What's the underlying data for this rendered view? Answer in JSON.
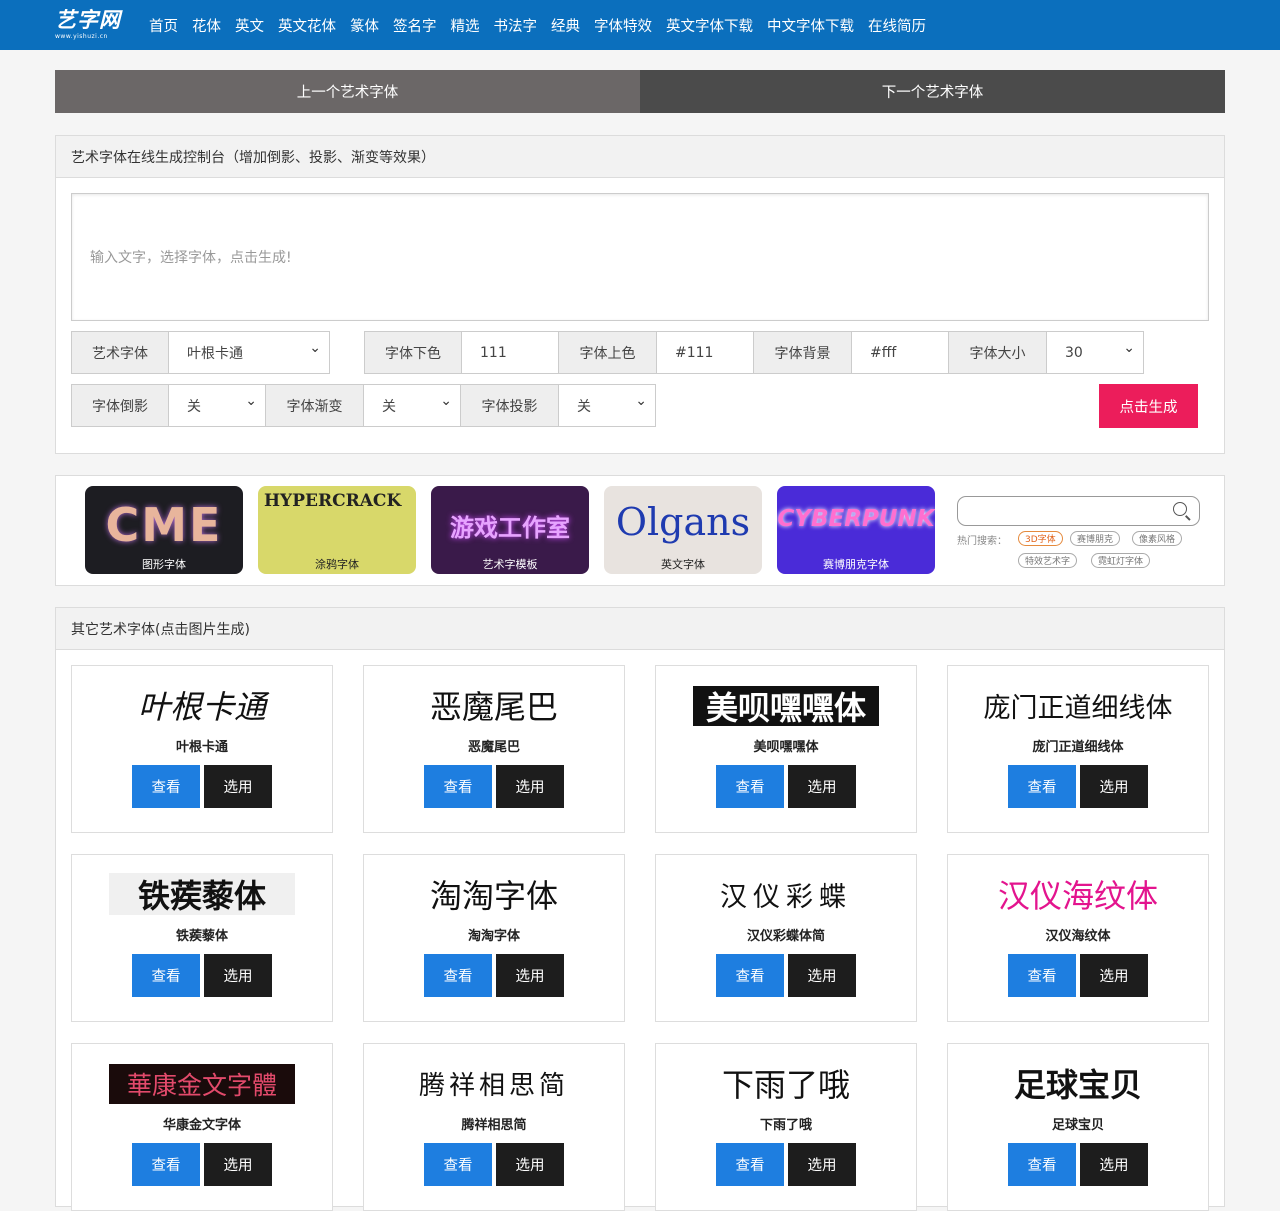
{
  "header": {
    "logo_text": "艺字网",
    "logo_sub": "www.yishuzi.cn",
    "nav": [
      "首页",
      "花体",
      "英文",
      "英文花体",
      "篆体",
      "签名字",
      "精选",
      "书法字",
      "经典",
      "字体特效",
      "英文字体下载",
      "中文字体下载",
      "在线简历"
    ]
  },
  "pager": {
    "prev": "上一个艺术字体",
    "next": "下一个艺术字体"
  },
  "control": {
    "title": "艺术字体在线生成控制台（增加倒影、投影、渐变等效果）",
    "textarea_placeholder": "输入文字，选择字体，点击生成!",
    "font_label": "艺术字体",
    "font_value": "叶根卡通",
    "bottom_color_label": "字体下色",
    "bottom_color_value": "111",
    "top_color_label": "字体上色",
    "top_color_value": "#111",
    "bg_label": "字体背景",
    "bg_value": "#fff",
    "size_label": "字体大小",
    "size_value": "30",
    "reflect_label": "字体倒影",
    "reflect_value": "关",
    "gradient_label": "字体渐变",
    "gradient_value": "关",
    "shadow_label": "字体投影",
    "shadow_value": "关",
    "generate_button": "点击生成"
  },
  "banner": {
    "tiles": [
      {
        "caption": "图形字体",
        "art": "CME"
      },
      {
        "caption": "涂鸦字体",
        "art": "HYPERCRACK"
      },
      {
        "caption": "艺术字模板",
        "art": "游戏工作室"
      },
      {
        "caption": "英文字体",
        "art": "Olgans"
      },
      {
        "caption": "赛博朋克字体",
        "art": "CYBERPUNK"
      }
    ],
    "hot_label": "热门搜索：",
    "tags": [
      "3D字体",
      "赛博朋克",
      "像素风格",
      "特效艺术字",
      "霓虹灯字体"
    ]
  },
  "fonts": {
    "title": "其它艺术字体(点击图片生成)",
    "view_label": "查看",
    "pick_label": "选用",
    "items": [
      {
        "preview": "叶根卡通",
        "name": "叶根卡通"
      },
      {
        "preview": "恶魔尾巴",
        "name": "恶魔尾巴"
      },
      {
        "preview": "美呗嘿嘿体",
        "name": "美呗嘿嘿体"
      },
      {
        "preview": "庞门正道细线体",
        "name": "庞门正道细线体"
      },
      {
        "preview": "铁蒺藜体",
        "name": "铁蒺藜体"
      },
      {
        "preview": "淘淘字体",
        "name": "淘淘字体"
      },
      {
        "preview": "汉仪彩蝶",
        "name": "汉仪彩蝶体简"
      },
      {
        "preview": "汉仪海纹体",
        "name": "汉仪海纹体"
      },
      {
        "preview": "華康金文字體",
        "name": "华康金文字体"
      },
      {
        "preview": "腾祥相思简",
        "name": "腾祥相思简"
      },
      {
        "preview": "下雨了哦",
        "name": "下雨了哦"
      },
      {
        "preview": "足球宝贝",
        "name": "足球宝贝"
      }
    ]
  }
}
